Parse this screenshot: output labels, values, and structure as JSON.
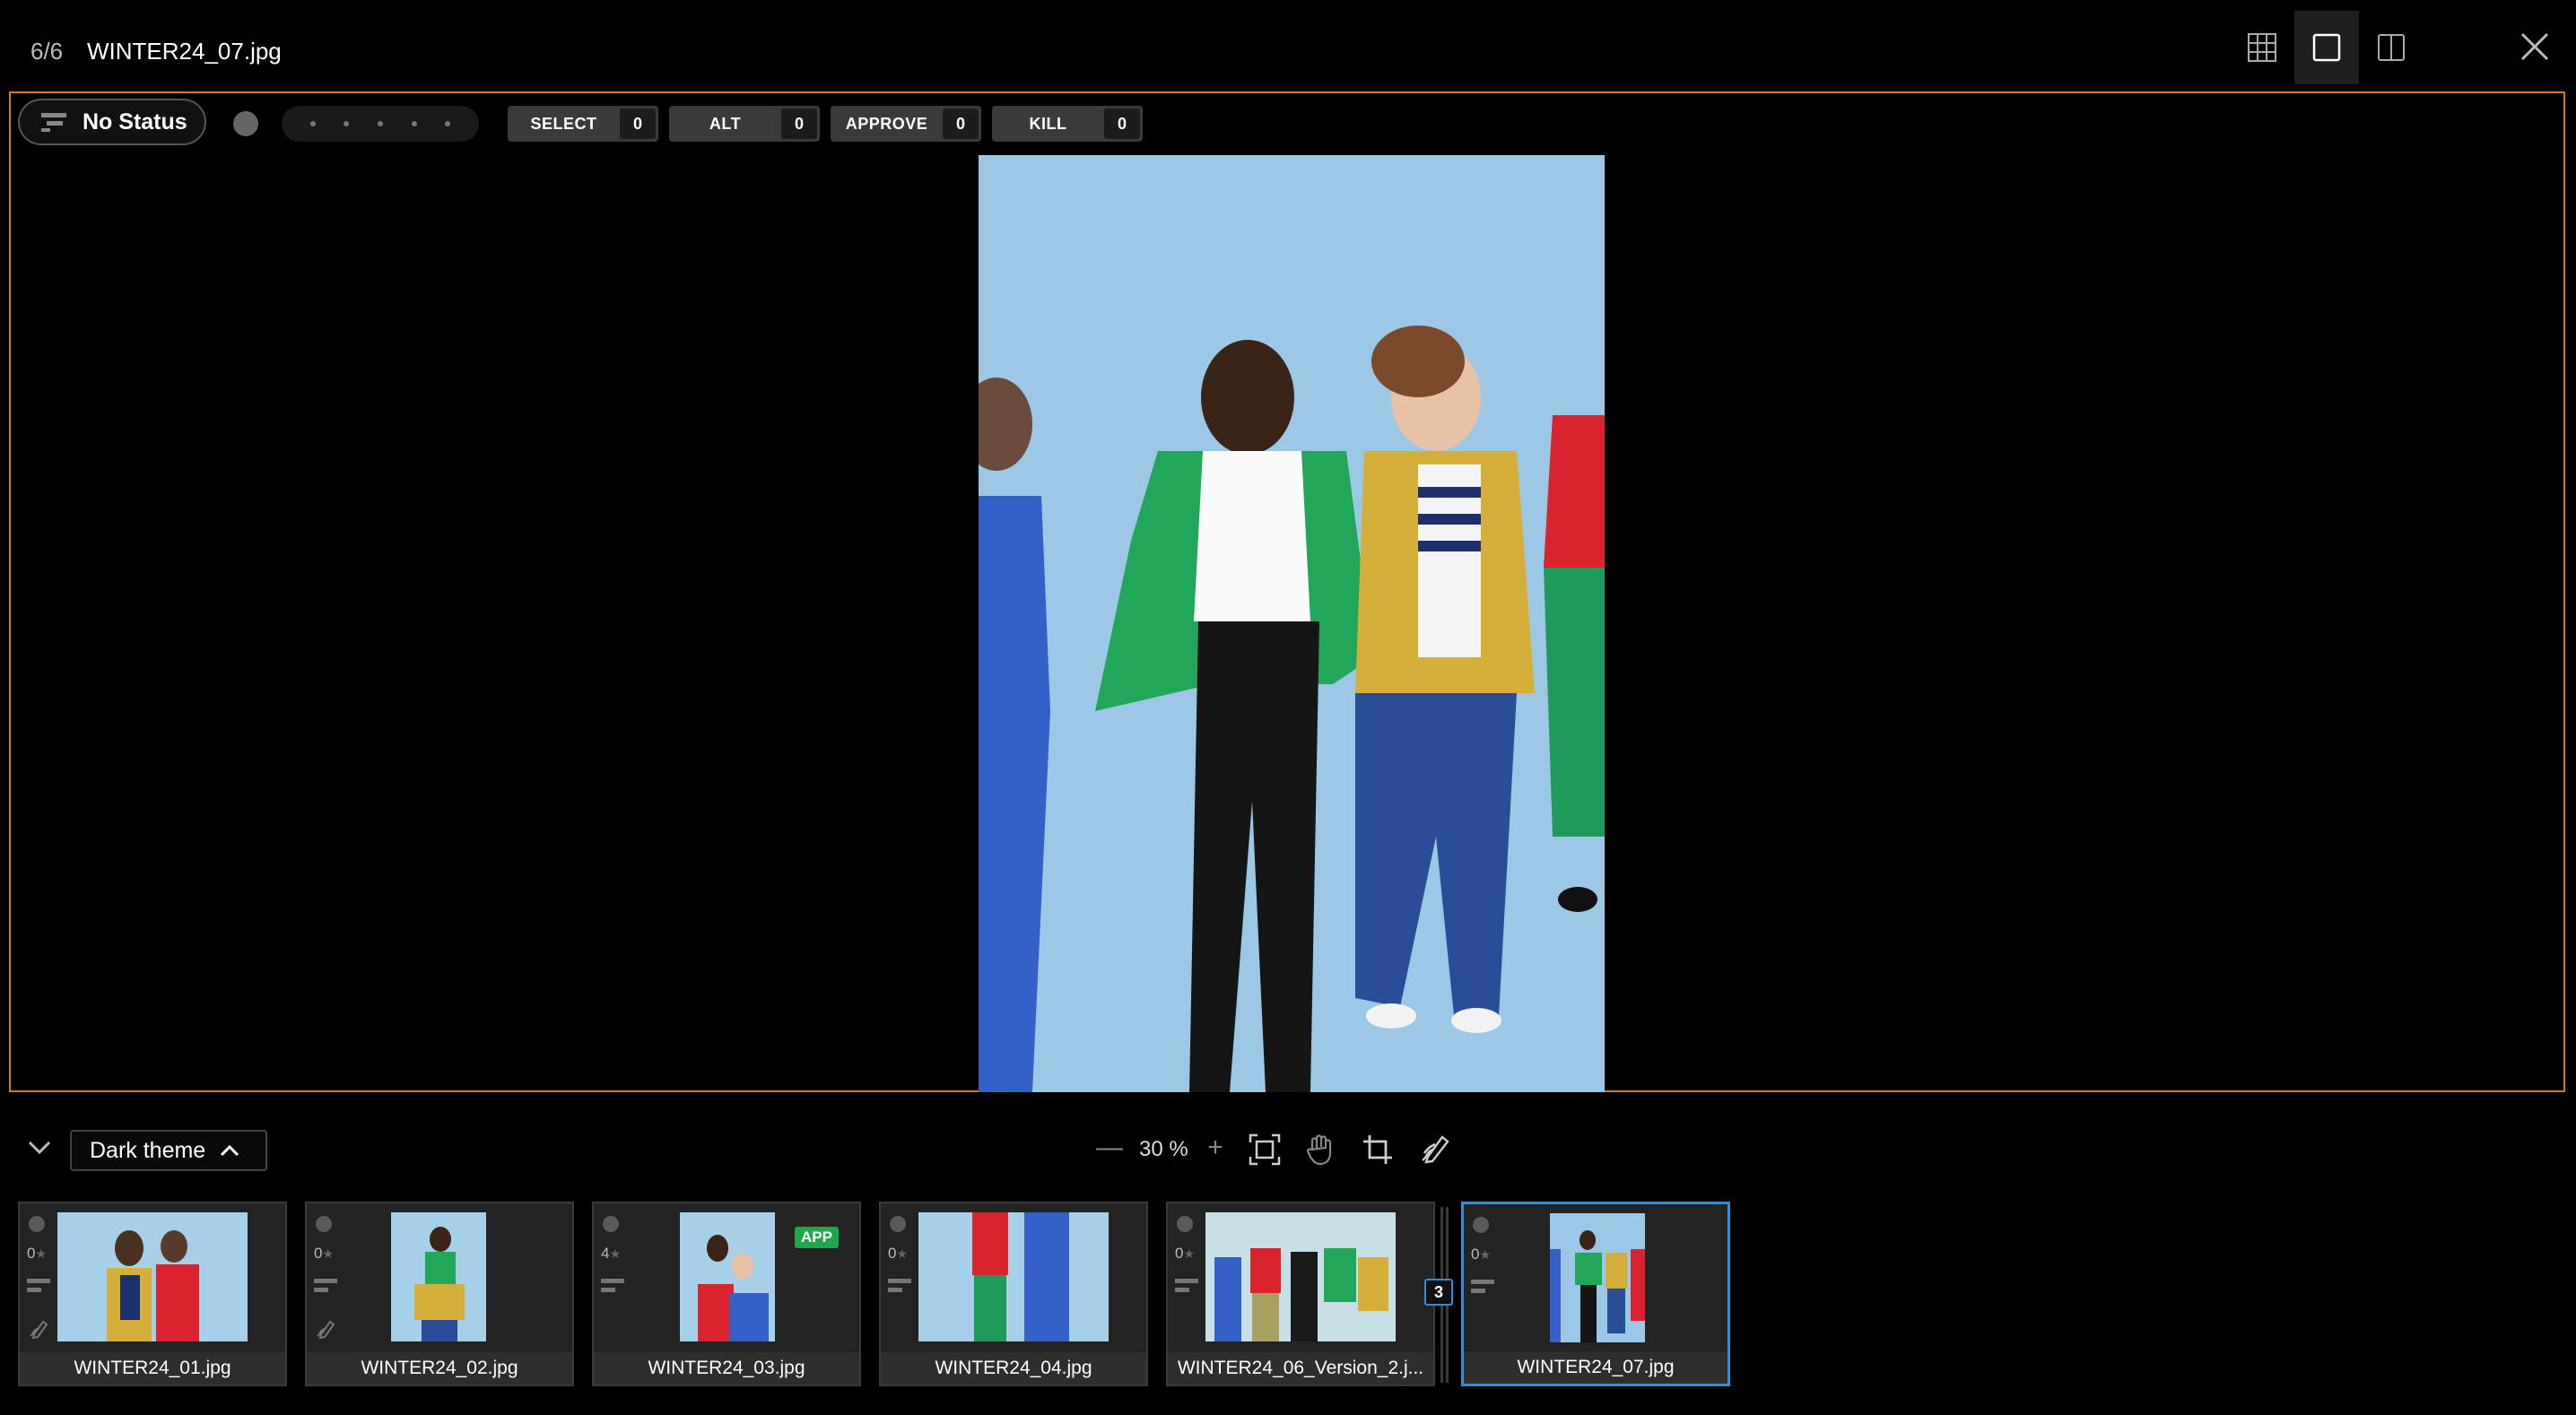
{
  "header": {
    "counter": "6/6",
    "filename": "WINTER24_07.jpg",
    "views": [
      {
        "name": "grid-view",
        "icon": "grid-icon",
        "active": false
      },
      {
        "name": "single-view",
        "icon": "single-square-icon",
        "active": true
      },
      {
        "name": "compare-view",
        "icon": "split-view-icon",
        "active": false
      }
    ],
    "close_icon": "close-icon"
  },
  "viewer": {
    "status_label": "No Status",
    "tags": [
      {
        "label": "SELECT",
        "count": "0"
      },
      {
        "label": "ALT",
        "count": "0"
      },
      {
        "label": "APPROVE",
        "count": "0"
      },
      {
        "label": "KILL",
        "count": "0"
      }
    ],
    "accent_border_color": "#d07a2c"
  },
  "toolbar": {
    "theme_label": "Dark theme",
    "zoom_minus": "—",
    "zoom_value": "30 %",
    "zoom_plus": "+"
  },
  "filmstrip": {
    "stack_count": "3",
    "items": [
      {
        "name": "WINTER24_01.jpg",
        "rating": "0",
        "badge": "",
        "selected": false
      },
      {
        "name": "WINTER24_02.jpg",
        "rating": "0",
        "badge": "",
        "selected": false
      },
      {
        "name": "WINTER24_03.jpg",
        "rating": "4",
        "badge": "APP",
        "selected": false
      },
      {
        "name": "WINTER24_04.jpg",
        "rating": "0",
        "badge": "",
        "selected": false
      },
      {
        "name": "WINTER24_06_Version_2.j...",
        "rating": "0",
        "badge": "",
        "selected": false
      },
      {
        "name": "WINTER24_07.jpg",
        "rating": "0",
        "badge": "",
        "selected": true
      }
    ]
  },
  "colors": {
    "selection_blue": "#2f8fd8",
    "app_badge_green": "#1fa84a",
    "photo_background": "#9cc8e6"
  }
}
